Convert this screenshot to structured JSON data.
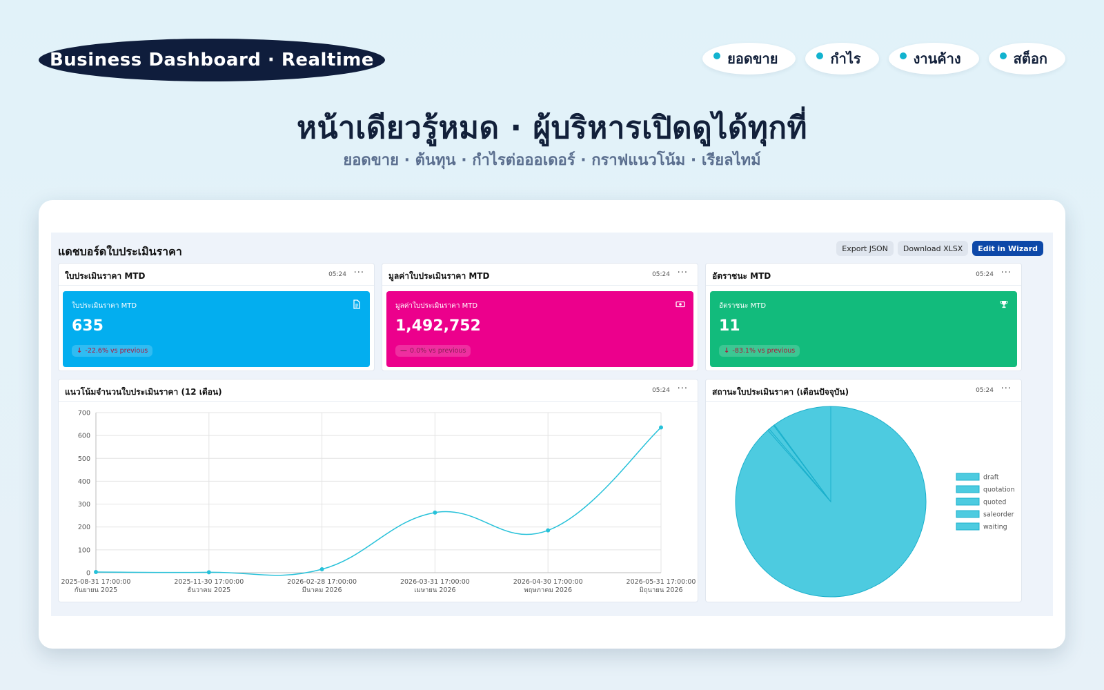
{
  "header": {
    "brand": "Business Dashboard · Realtime",
    "tags": [
      "ยอดขาย",
      "กำไร",
      "งานค้าง",
      "สต็อก"
    ],
    "title": "หน้าเดียวรู้หมด · ผู้บริหารเปิดดูได้ทุกที่",
    "subtitle": "ยอดขาย · ต้นทุน · กำไรต่อออเดอร์ · กราฟแนวโน้ม · เรียลไทม์"
  },
  "dashboard": {
    "title": "แดชบอร์ดใบประเมินราคา",
    "actions": {
      "export_json": "Export JSON",
      "download_xlsx": "Download XLSX",
      "edit_wizard": "Edit in Wizard"
    },
    "kpis": [
      {
        "panel_title": "ใบประเมินราคา MTD",
        "time": "05:24",
        "label": "ใบประเมินราคา MTD",
        "value": "635",
        "delta": "-22.6% vs previous",
        "trend": "down",
        "color": "#03aeef",
        "icon": "document-icon"
      },
      {
        "panel_title": "มูลค่าใบประเมินราคา MTD",
        "time": "05:24",
        "label": "มูลค่าใบประเมินราคา MTD",
        "value": "1,492,752",
        "delta": "0.0% vs previous",
        "trend": "flat",
        "color": "#ec008c",
        "icon": "money-icon"
      },
      {
        "panel_title": "อัตราชนะ MTD",
        "time": "05:24",
        "label": "อัตราชนะ MTD",
        "value": "11",
        "delta": "-83.1% vs previous",
        "trend": "down",
        "color": "#12bb7c",
        "icon": "trophy-icon"
      }
    ],
    "trend_panel": {
      "title": "แนวโน้มจำนวนใบประเมินราคา (12 เดือน)",
      "time": "05:24"
    },
    "status_panel": {
      "title": "สถานะใบประเมินราคา (เดือนปัจจุบัน)",
      "time": "05:24"
    },
    "menu_glyph": "···"
  },
  "chart_data": [
    {
      "type": "line",
      "title": "แนวโน้มจำนวนใบประเมินราคา (12 เดือน)",
      "x": [
        "2025-08-31 17:00:00",
        "2025-11-30 17:00:00",
        "2026-02-28 17:00:00",
        "2026-03-31 17:00:00",
        "2026-04-30 17:00:00",
        "2026-05-31 17:00:00"
      ],
      "x_sublabels": [
        "กันยายน 2025",
        "ธันวาคม 2025",
        "มีนาคม 2026",
        "เมษายน 2026",
        "พฤษภาคม 2026",
        "มิถุนายน 2026"
      ],
      "values": [
        3,
        2,
        15,
        263,
        185,
        635
      ],
      "ylim": [
        0,
        700
      ],
      "yticks": [
        0,
        100,
        200,
        300,
        400,
        500,
        600,
        700
      ],
      "grid": true,
      "color": "#26c1d9"
    },
    {
      "type": "pie",
      "title": "สถานะใบประเมินราคา (เดือนปัจจุบัน)",
      "labels": [
        "draft",
        "quotation",
        "quoted",
        "saleorder",
        "waiting"
      ],
      "values": [
        562,
        2,
        6,
        1,
        64
      ],
      "color": "#4dcbe0",
      "legend": "right"
    }
  ]
}
